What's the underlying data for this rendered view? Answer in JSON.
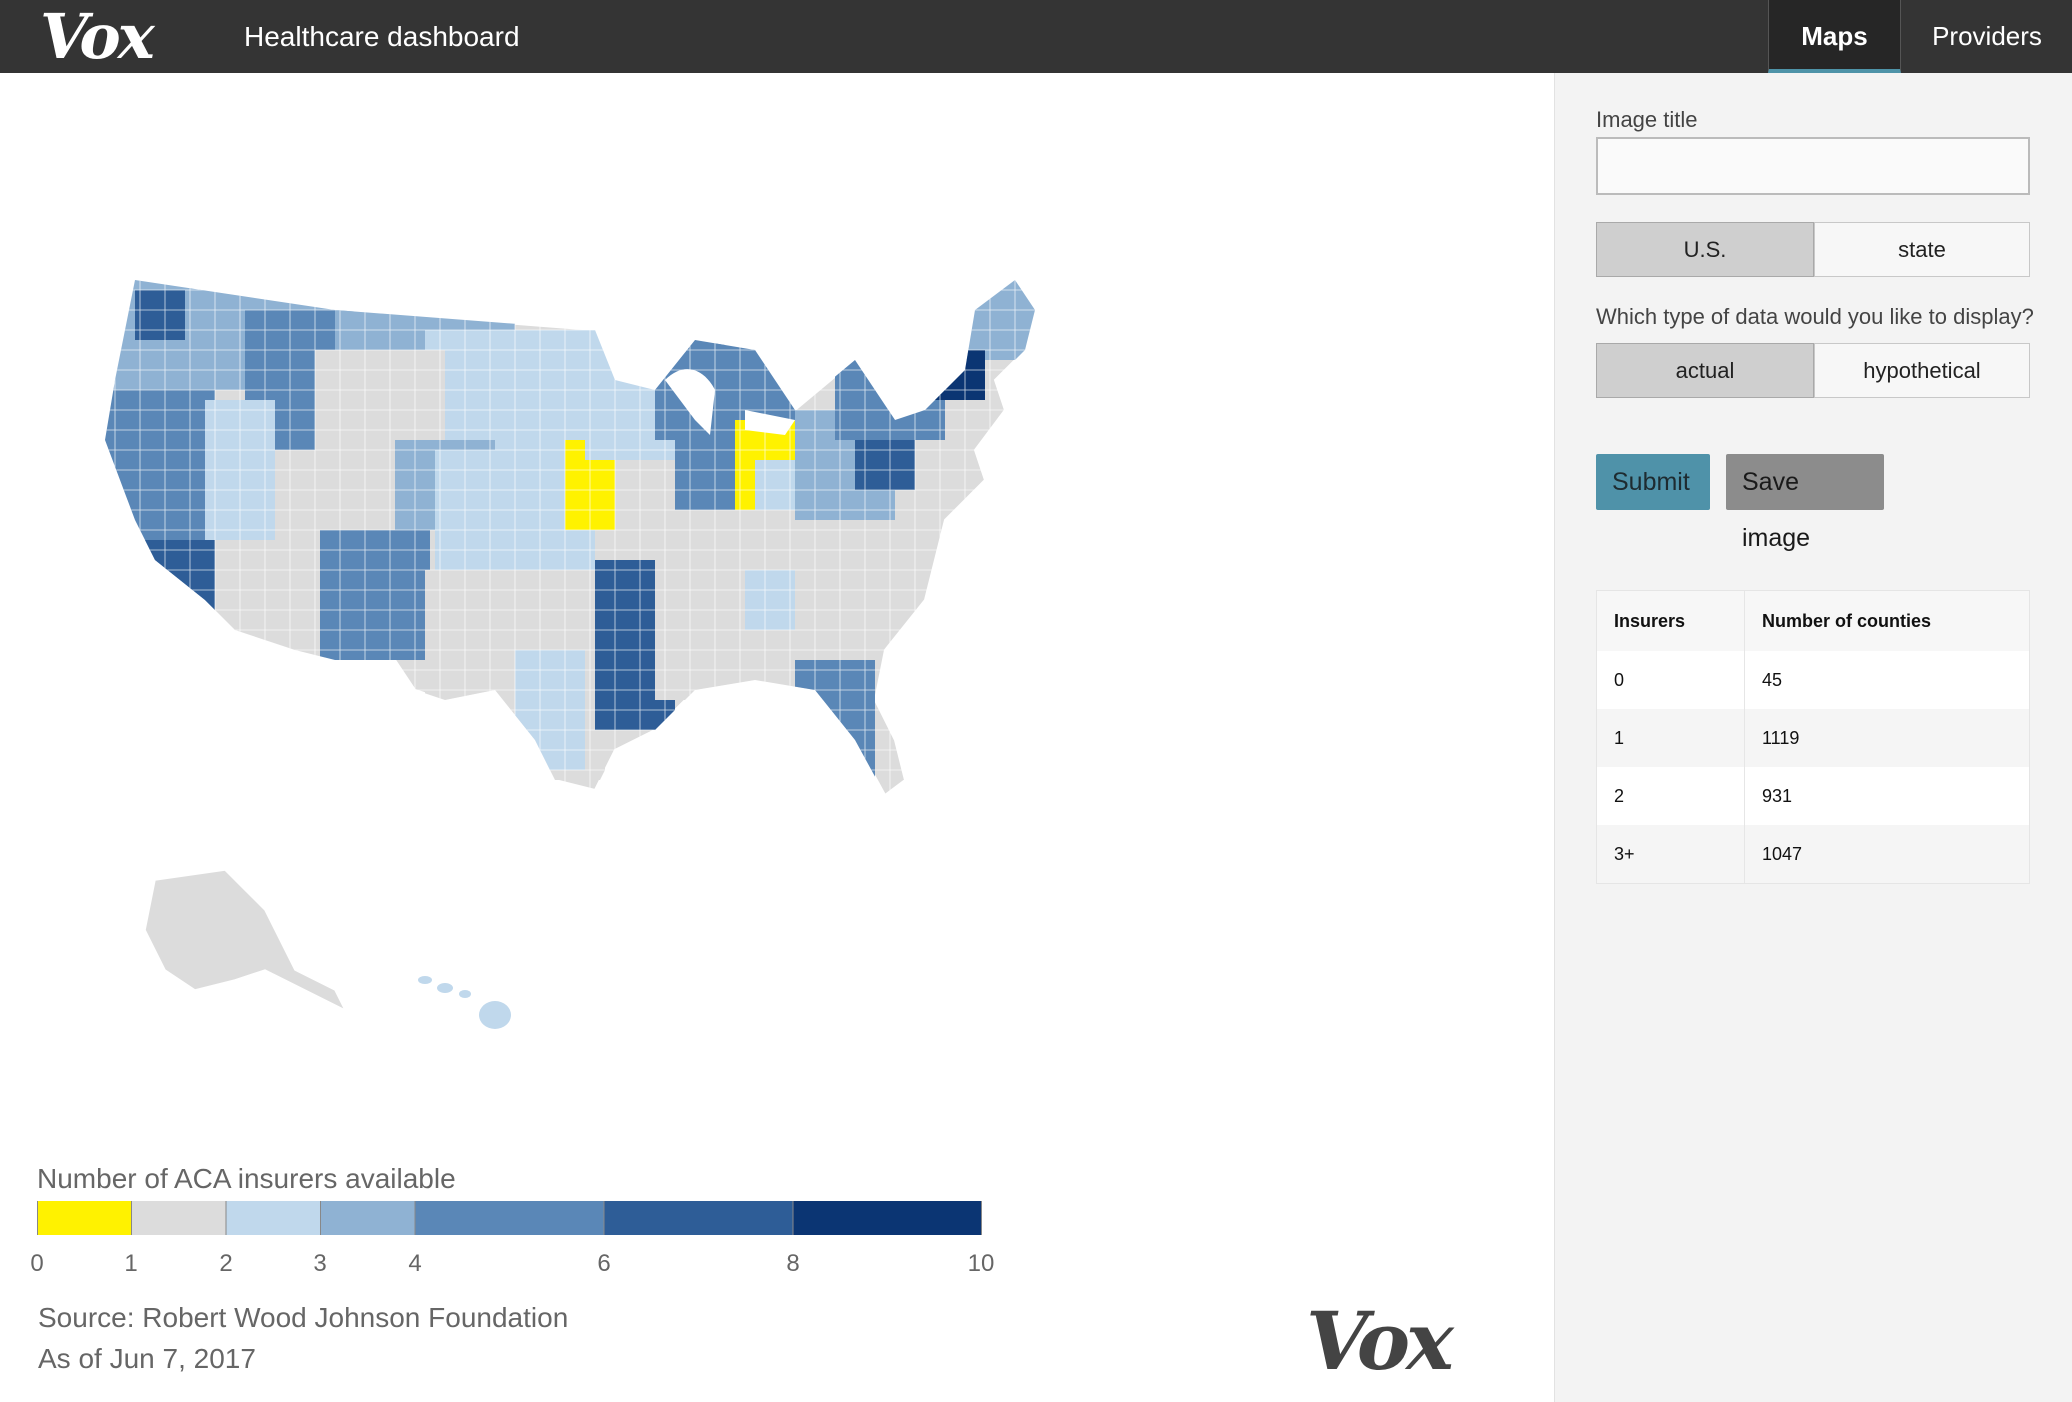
{
  "header": {
    "logo": "Vox",
    "title": "Healthcare dashboard",
    "tabs": [
      "Maps",
      "Providers"
    ]
  },
  "sidebar": {
    "image_title_label": "Image title",
    "image_title_value": "",
    "scope": {
      "options": [
        "U.S.",
        "state"
      ],
      "selected": "U.S."
    },
    "data_type_label": "Which type of data would you like to display?",
    "data_type": {
      "options": [
        "actual",
        "hypothetical"
      ],
      "selected": "actual"
    },
    "submit_label": "Submit",
    "save_label": "Save image",
    "table": {
      "headers": [
        "Insurers",
        "Number of counties"
      ],
      "rows": [
        [
          "0",
          "45"
        ],
        [
          "1",
          "1119"
        ],
        [
          "2",
          "931"
        ],
        [
          "3+",
          "1047"
        ]
      ]
    }
  },
  "legend": {
    "title": "Number of ACA insurers available",
    "ticks": [
      "0",
      "1",
      "2",
      "3",
      "4",
      "6",
      "8",
      "10"
    ],
    "colors": {
      "zero": "#fff200",
      "one": "#dcdcdc",
      "two": "#c0d8ec",
      "three": "#8fb2d3",
      "four": "#5a87b7",
      "six": "#2e5d97",
      "eight": "#0b3573"
    }
  },
  "source": "Source: Robert Wood Johnson Foundation",
  "as_of": "As of Jun 7, 2017",
  "footer_logo": "Vox"
}
